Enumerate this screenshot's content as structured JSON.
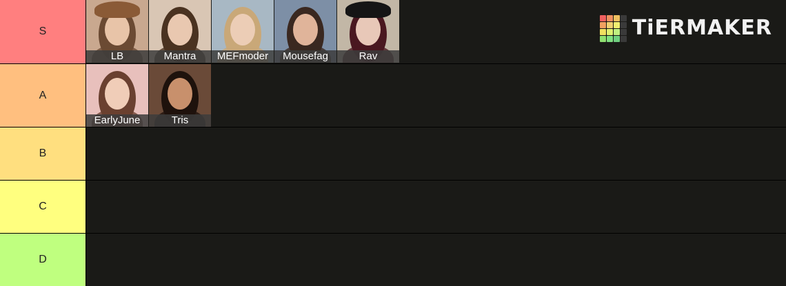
{
  "logo": {
    "text": "TiERMAKER",
    "grid_colors": [
      "#f06060",
      "#f09060",
      "#f0c060",
      "#3a3a3a",
      "#f0a060",
      "#f0d070",
      "#f0f070",
      "#3a3a3a",
      "#f0e060",
      "#e0f070",
      "#c0f080",
      "#3a3a3a",
      "#90e070",
      "#80e080",
      "#70d080",
      "#3a3a3a"
    ]
  },
  "tiers": [
    {
      "label": "S",
      "color": "#ff7f7f",
      "items": [
        {
          "caption": "LB",
          "bg": "#c9a88f",
          "hair": "#6b4a33",
          "face": "#e8c4a8",
          "hat": "#8a5a36"
        },
        {
          "caption": "Mantra",
          "bg": "#d9c6b4",
          "hair": "#4a3220",
          "face": "#e9c8b0",
          "hat": ""
        },
        {
          "caption": "MEFmoder",
          "bg": "#a8b8c4",
          "hair": "#c9a878",
          "face": "#eccdb6",
          "hat": ""
        },
        {
          "caption": "Mousefag",
          "bg": "#7d8fa6",
          "hair": "#3a2820",
          "face": "#e0b49a",
          "hat": ""
        },
        {
          "caption": "Rav",
          "bg": "#c2b7a6",
          "hair": "#4a1820",
          "face": "#e8c8b8",
          "hat": "#151515"
        }
      ]
    },
    {
      "label": "A",
      "color": "#ffbf7f",
      "items": [
        {
          "caption": "EarlyJune",
          "bg": "#e8c0bc",
          "hair": "#6a4030",
          "face": "#f0cdb8",
          "hat": ""
        },
        {
          "caption": "Tris",
          "bg": "#6a4a38",
          "hair": "#1e120c",
          "face": "#c8906c",
          "hat": ""
        }
      ]
    },
    {
      "label": "B",
      "color": "#ffdf7f",
      "items": []
    },
    {
      "label": "C",
      "color": "#ffff7f",
      "items": []
    },
    {
      "label": "D",
      "color": "#bfff7f",
      "items": []
    }
  ]
}
